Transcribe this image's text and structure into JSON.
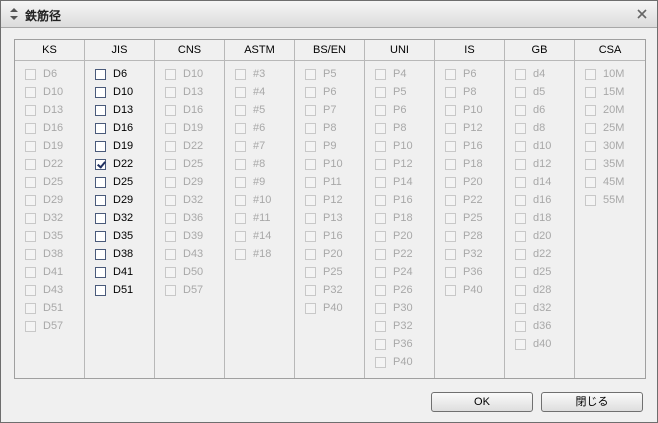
{
  "window": {
    "title": "鉄筋径",
    "title_icon": "diamond-arrows-icon",
    "close_icon": "close-icon"
  },
  "columns": [
    {
      "header": "KS",
      "enabled": false,
      "items": [
        "D6",
        "D10",
        "D13",
        "D16",
        "D19",
        "D22",
        "D25",
        "D29",
        "D32",
        "D35",
        "D38",
        "D41",
        "D43",
        "D51",
        "D57"
      ],
      "checked": []
    },
    {
      "header": "JIS",
      "enabled": true,
      "items": [
        "D6",
        "D10",
        "D13",
        "D16",
        "D19",
        "D22",
        "D25",
        "D29",
        "D32",
        "D35",
        "D38",
        "D41",
        "D51"
      ],
      "checked": [
        "D22"
      ]
    },
    {
      "header": "CNS",
      "enabled": false,
      "items": [
        "D10",
        "D13",
        "D16",
        "D19",
        "D22",
        "D25",
        "D29",
        "D32",
        "D36",
        "D39",
        "D43",
        "D50",
        "D57"
      ],
      "checked": []
    },
    {
      "header": "ASTM",
      "enabled": false,
      "items": [
        "#3",
        "#4",
        "#5",
        "#6",
        "#7",
        "#8",
        "#9",
        "#10",
        "#11",
        "#14",
        "#18"
      ],
      "checked": []
    },
    {
      "header": "BS/EN",
      "enabled": false,
      "items": [
        "P5",
        "P6",
        "P7",
        "P8",
        "P9",
        "P10",
        "P11",
        "P12",
        "P13",
        "P16",
        "P20",
        "P25",
        "P32",
        "P40"
      ],
      "checked": []
    },
    {
      "header": "UNI",
      "enabled": false,
      "items": [
        "P4",
        "P5",
        "P6",
        "P8",
        "P10",
        "P12",
        "P14",
        "P16",
        "P18",
        "P20",
        "P22",
        "P24",
        "P26",
        "P30",
        "P32",
        "P36",
        "P40"
      ],
      "checked": []
    },
    {
      "header": "IS",
      "enabled": false,
      "items": [
        "P6",
        "P8",
        "P10",
        "P12",
        "P16",
        "P18",
        "P20",
        "P22",
        "P25",
        "P28",
        "P32",
        "P36",
        "P40"
      ],
      "checked": []
    },
    {
      "header": "GB",
      "enabled": false,
      "items": [
        "d4",
        "d5",
        "d6",
        "d8",
        "d10",
        "d12",
        "d14",
        "d16",
        "d18",
        "d20",
        "d22",
        "d25",
        "d28",
        "d32",
        "d36",
        "d40"
      ],
      "checked": []
    },
    {
      "header": "CSA",
      "enabled": false,
      "items": [
        "10M",
        "15M",
        "20M",
        "25M",
        "30M",
        "35M",
        "45M",
        "55M"
      ],
      "checked": []
    }
  ],
  "buttons": {
    "ok": "OK",
    "close": "閉じる"
  }
}
